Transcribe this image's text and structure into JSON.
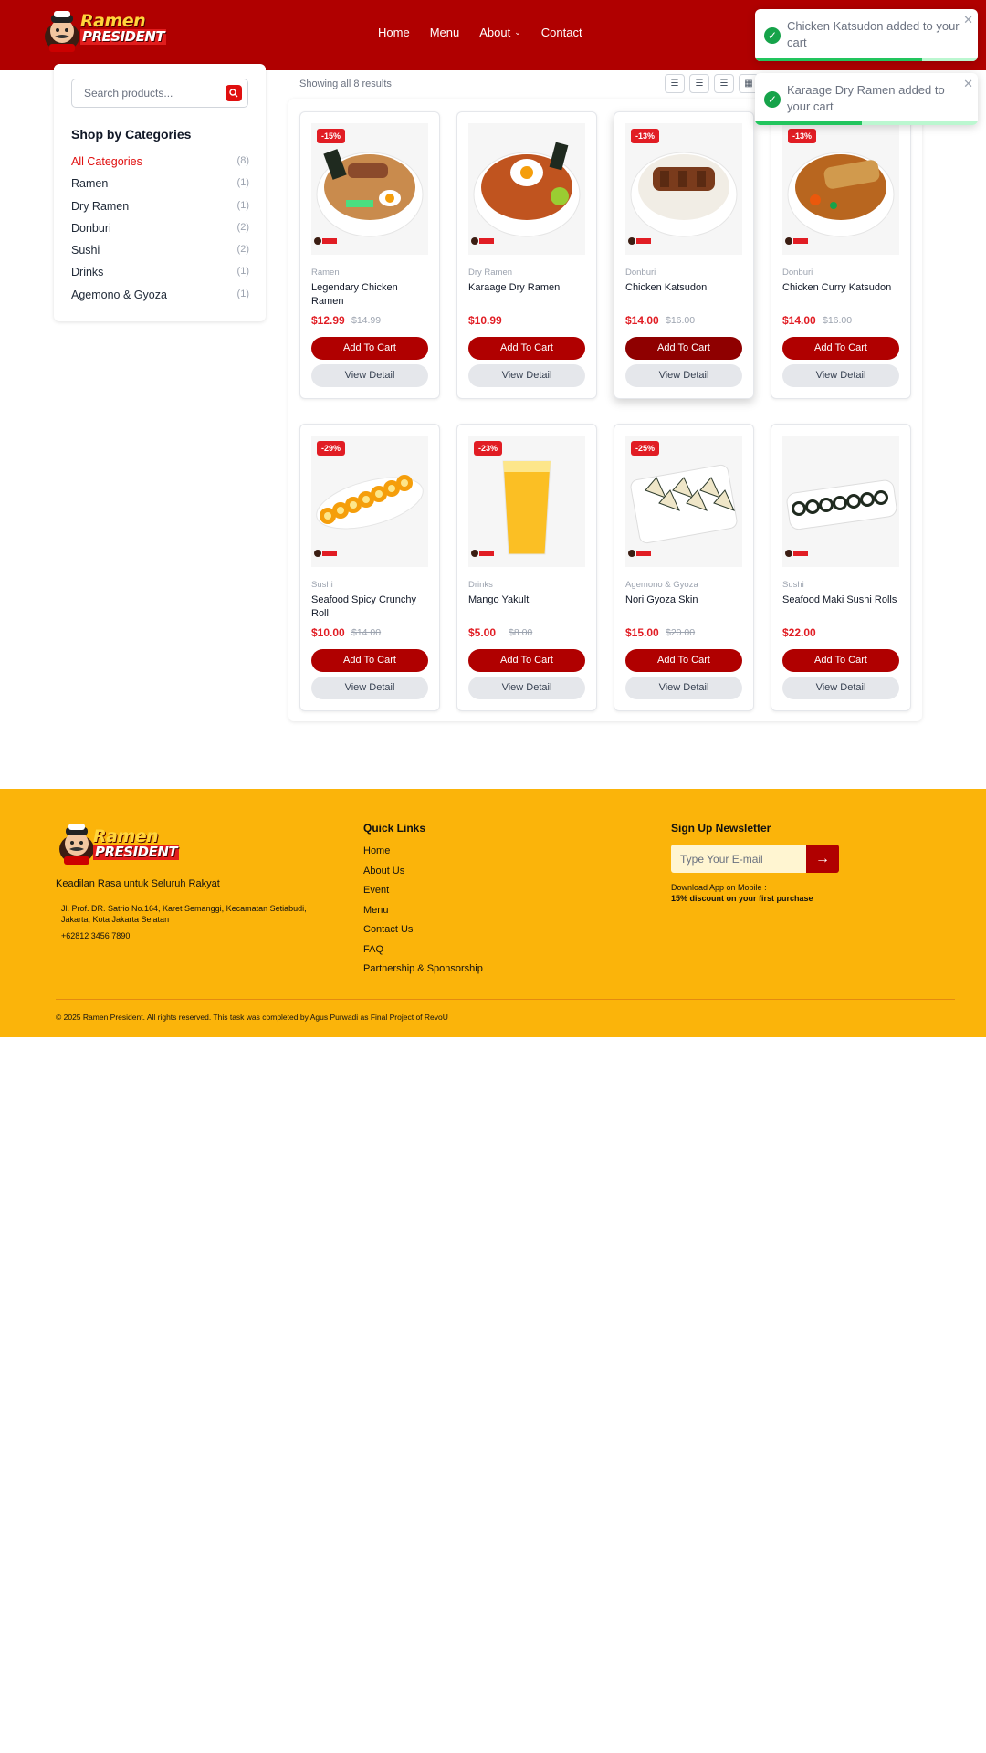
{
  "brand": {
    "line1": "Ramen",
    "line2": "PRESIDENT",
    "color": "#b00000",
    "accent": "#e11d24"
  },
  "nav": [
    {
      "label": "Home"
    },
    {
      "label": "Menu"
    },
    {
      "label": "About"
    },
    {
      "label": "Contact"
    }
  ],
  "toasts": [
    {
      "message": "Chicken Katsudon added to your cart",
      "progress": 0.75
    },
    {
      "message": "Karaage Dry Ramen added to your cart",
      "progress": 0.48
    }
  ],
  "sidebar": {
    "search_placeholder": "Search products...",
    "title": "Shop by Categories",
    "categories": [
      {
        "name": "All Categories",
        "count": "(8)"
      },
      {
        "name": "Ramen",
        "count": "(1)"
      },
      {
        "name": "Dry Ramen",
        "count": "(1)"
      },
      {
        "name": "Donburi",
        "count": "(2)"
      },
      {
        "name": "Sushi",
        "count": "(2)"
      },
      {
        "name": "Drinks",
        "count": "(1)"
      },
      {
        "name": "Agemono & Gyoza",
        "count": "(1)"
      }
    ]
  },
  "listing": {
    "result_text": "Showing all 8 results"
  },
  "buttons": {
    "add_to_cart": "Add To Cart",
    "view_detail": "View Detail"
  },
  "products": [
    {
      "category": "Ramen",
      "name": "Legendary Chicken Ramen",
      "price": "$12.99",
      "old_price": "$14.99",
      "discount": "-15%",
      "image": "ramen-bowl"
    },
    {
      "category": "Dry Ramen",
      "name": "Karaage Dry Ramen",
      "price": "$10.99",
      "old_price": "",
      "discount": "",
      "image": "dry-ramen-bowl"
    },
    {
      "category": "Donburi",
      "name": "Chicken Katsudon",
      "price": "$14.00",
      "old_price": "$16.00",
      "discount": "-13%",
      "image": "katsudon-bowl"
    },
    {
      "category": "Donburi",
      "name": "Chicken Curry Katsudon",
      "price": "$14.00",
      "old_price": "$16.00",
      "discount": "-13%",
      "image": "curry-plate"
    },
    {
      "category": "Sushi",
      "name": "Seafood Spicy Crunchy Roll",
      "price": "$10.00",
      "old_price": "$14.00",
      "discount": "-29%",
      "image": "sushi-plate"
    },
    {
      "category": "Drinks",
      "name": "Mango Yakult",
      "price": "$5.00",
      "old_price": "$8.00",
      "discount": "-23%",
      "image": "mango-drink"
    },
    {
      "category": "Agemono & Gyoza",
      "name": "Nori Gyoza Skin",
      "price": "$15.00",
      "old_price": "$20.00",
      "discount": "-25%",
      "image": "gyoza-plate"
    },
    {
      "category": "Sushi",
      "name": "Seafood Maki Sushi Rolls",
      "price": "$22.00",
      "old_price": "",
      "discount": "",
      "image": "maki-plate"
    }
  ],
  "footer": {
    "tagline": "Keadilan Rasa untuk Seluruh Rakyat",
    "address": "Jl. Prof. DR. Satrio No.164, Karet Semanggi, Kecamatan Setiabudi, Jakarta, Kota Jakarta Selatan",
    "phone": "+62812 3456 7890",
    "quick_links_title": "Quick Links",
    "quick_links": [
      "Home",
      "About Us",
      "Event",
      "Menu",
      "Contact Us",
      "FAQ",
      "Partnership & Sponsorship"
    ],
    "newsletter_title": "Sign Up Newsletter",
    "newsletter_placeholder": "Type Your E-mail",
    "newsletter_button": "→",
    "app_line1": "Download App on Mobile :",
    "app_line2": "15% discount on your first purchase",
    "copyright": "© 2025 Ramen President. All rights reserved. This task was completed by Agus Purwadi as Final Project of RevoU",
    "background": "#fbb40a"
  }
}
